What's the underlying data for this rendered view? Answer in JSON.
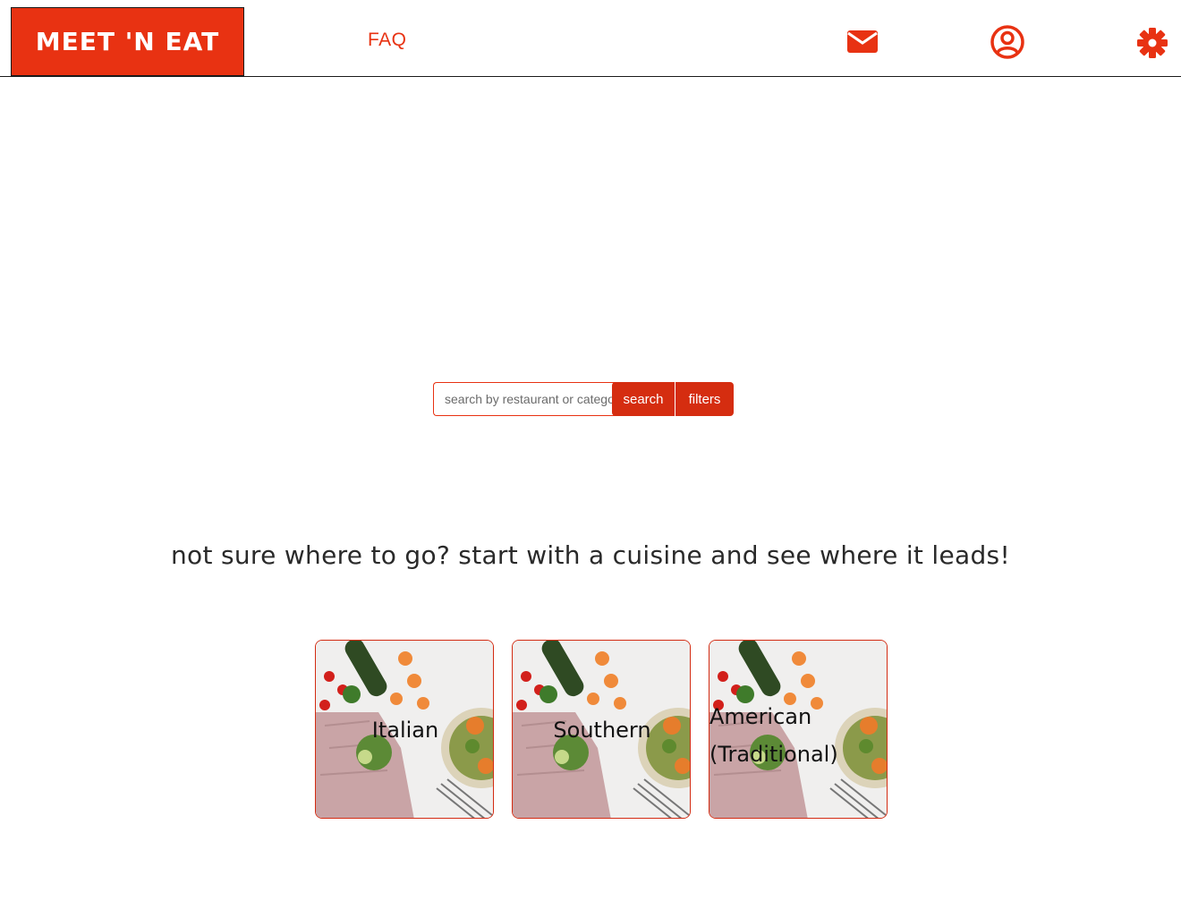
{
  "header": {
    "logo": "MEET 'N EAT",
    "nav_faq": "FAQ",
    "icons": [
      "envelope-icon",
      "user-circle-icon",
      "gear-icon"
    ]
  },
  "search": {
    "placeholder": "search by restaurant or category",
    "search_label": "search",
    "filters_label": "filters"
  },
  "main": {
    "tagline": "not sure where to go? start with a cuisine and see where it leads!",
    "cuisines": [
      {
        "label": "Italian"
      },
      {
        "label": "Southern"
      },
      {
        "label": "American (Traditional)"
      }
    ]
  },
  "colors": {
    "accent": "#e83212",
    "button": "#d52d10",
    "text": "#2a2a2a"
  }
}
